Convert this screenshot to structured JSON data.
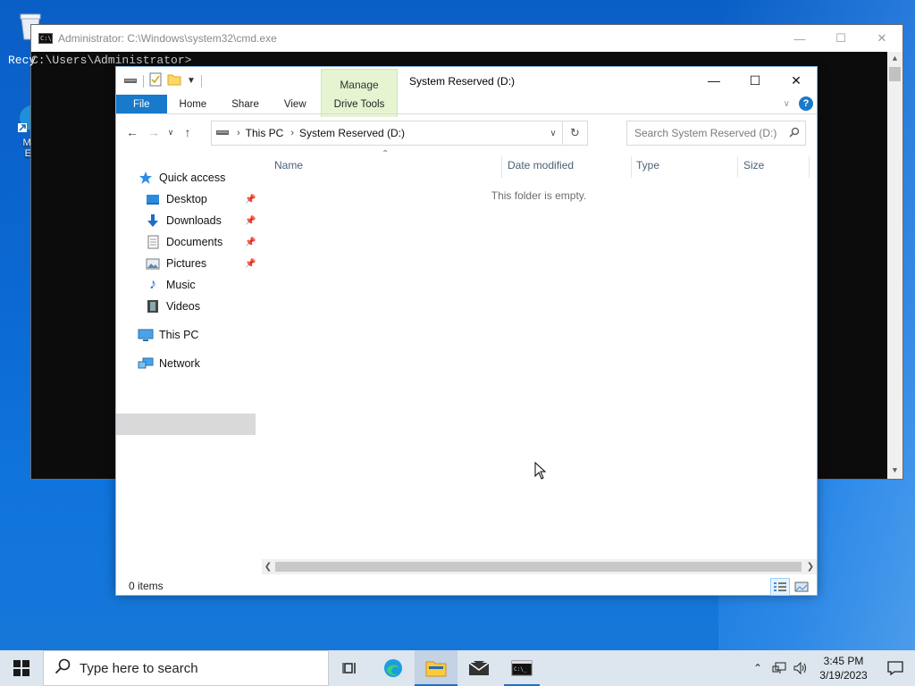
{
  "desktop": {
    "icons": [
      {
        "label": "Recy"
      },
      {
        "label": "Micr\nEd"
      }
    ]
  },
  "cmd": {
    "title": "Administrator: C:\\Windows\\system32\\cmd.exe",
    "prompt": "C:\\Users\\Administrator>",
    "prefix": "Recy"
  },
  "explorer": {
    "title": "System Reserved (D:)",
    "manage_tab": "Manage",
    "ribbon_tabs": [
      "File",
      "Home",
      "Share",
      "View"
    ],
    "drive_tools_tab": "Drive Tools",
    "address": {
      "crumbs": [
        "This PC",
        "System Reserved (D:)"
      ]
    },
    "search_placeholder": "Search System Reserved (D:)",
    "nav": {
      "quick_access": "Quick access",
      "items": [
        {
          "label": "Desktop",
          "pinned": true
        },
        {
          "label": "Downloads",
          "pinned": true
        },
        {
          "label": "Documents",
          "pinned": true
        },
        {
          "label": "Pictures",
          "pinned": true
        },
        {
          "label": "Music",
          "pinned": false
        },
        {
          "label": "Videos",
          "pinned": false
        }
      ],
      "this_pc": "This PC",
      "network": "Network"
    },
    "columns": [
      "Name",
      "Date modified",
      "Type",
      "Size"
    ],
    "empty_message": "This folder is empty.",
    "status": "0 items"
  },
  "taskbar": {
    "search_placeholder": "Type here to search",
    "time": "3:45 PM",
    "date": "3/19/2023"
  },
  "colors": {
    "accent": "#1979ca",
    "desktop": "#0b67d1",
    "manage_tab": "#e6f4d2",
    "taskbar": "#dde5ee"
  }
}
